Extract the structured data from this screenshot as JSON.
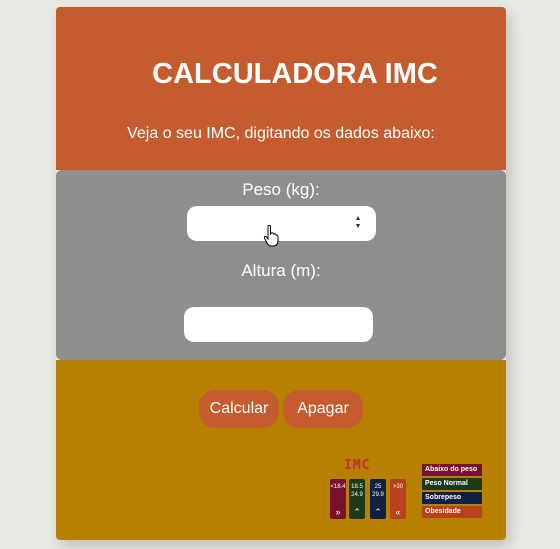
{
  "header": {
    "title": "CALCULADORA IMC",
    "subtitle": "Veja o seu IMC, digitando os dados abaixo:"
  },
  "form": {
    "peso_label": "Peso (kg):",
    "peso_value": "",
    "altura_label": "Altura (m):",
    "altura_value": ""
  },
  "buttons": {
    "calcular": "Calcular",
    "apagar": "Apagar"
  },
  "imc_image": {
    "title": "IMC",
    "columns": [
      {
        "label": "<18.4",
        "icon": "double-chevron-right-icon"
      },
      {
        "label": "18.5 24.9",
        "icon": "double-chevron-up-icon"
      },
      {
        "label": "25 29.9",
        "icon": "double-chevron-up-icon"
      },
      {
        "label": ">30",
        "icon": "double-chevron-left-icon"
      }
    ],
    "legend": [
      {
        "label": "Abaixo do peso",
        "color": "#7a1030"
      },
      {
        "label": "Peso Normal",
        "color": "#1c3a18"
      },
      {
        "label": "Sobrepeso",
        "color": "#102040"
      },
      {
        "label": "Obesidade",
        "color": "#b8401a"
      }
    ]
  },
  "colors": {
    "header": "#c45c30",
    "form": "#908e8c",
    "footer": "#b88000",
    "button": "#c45c30"
  }
}
